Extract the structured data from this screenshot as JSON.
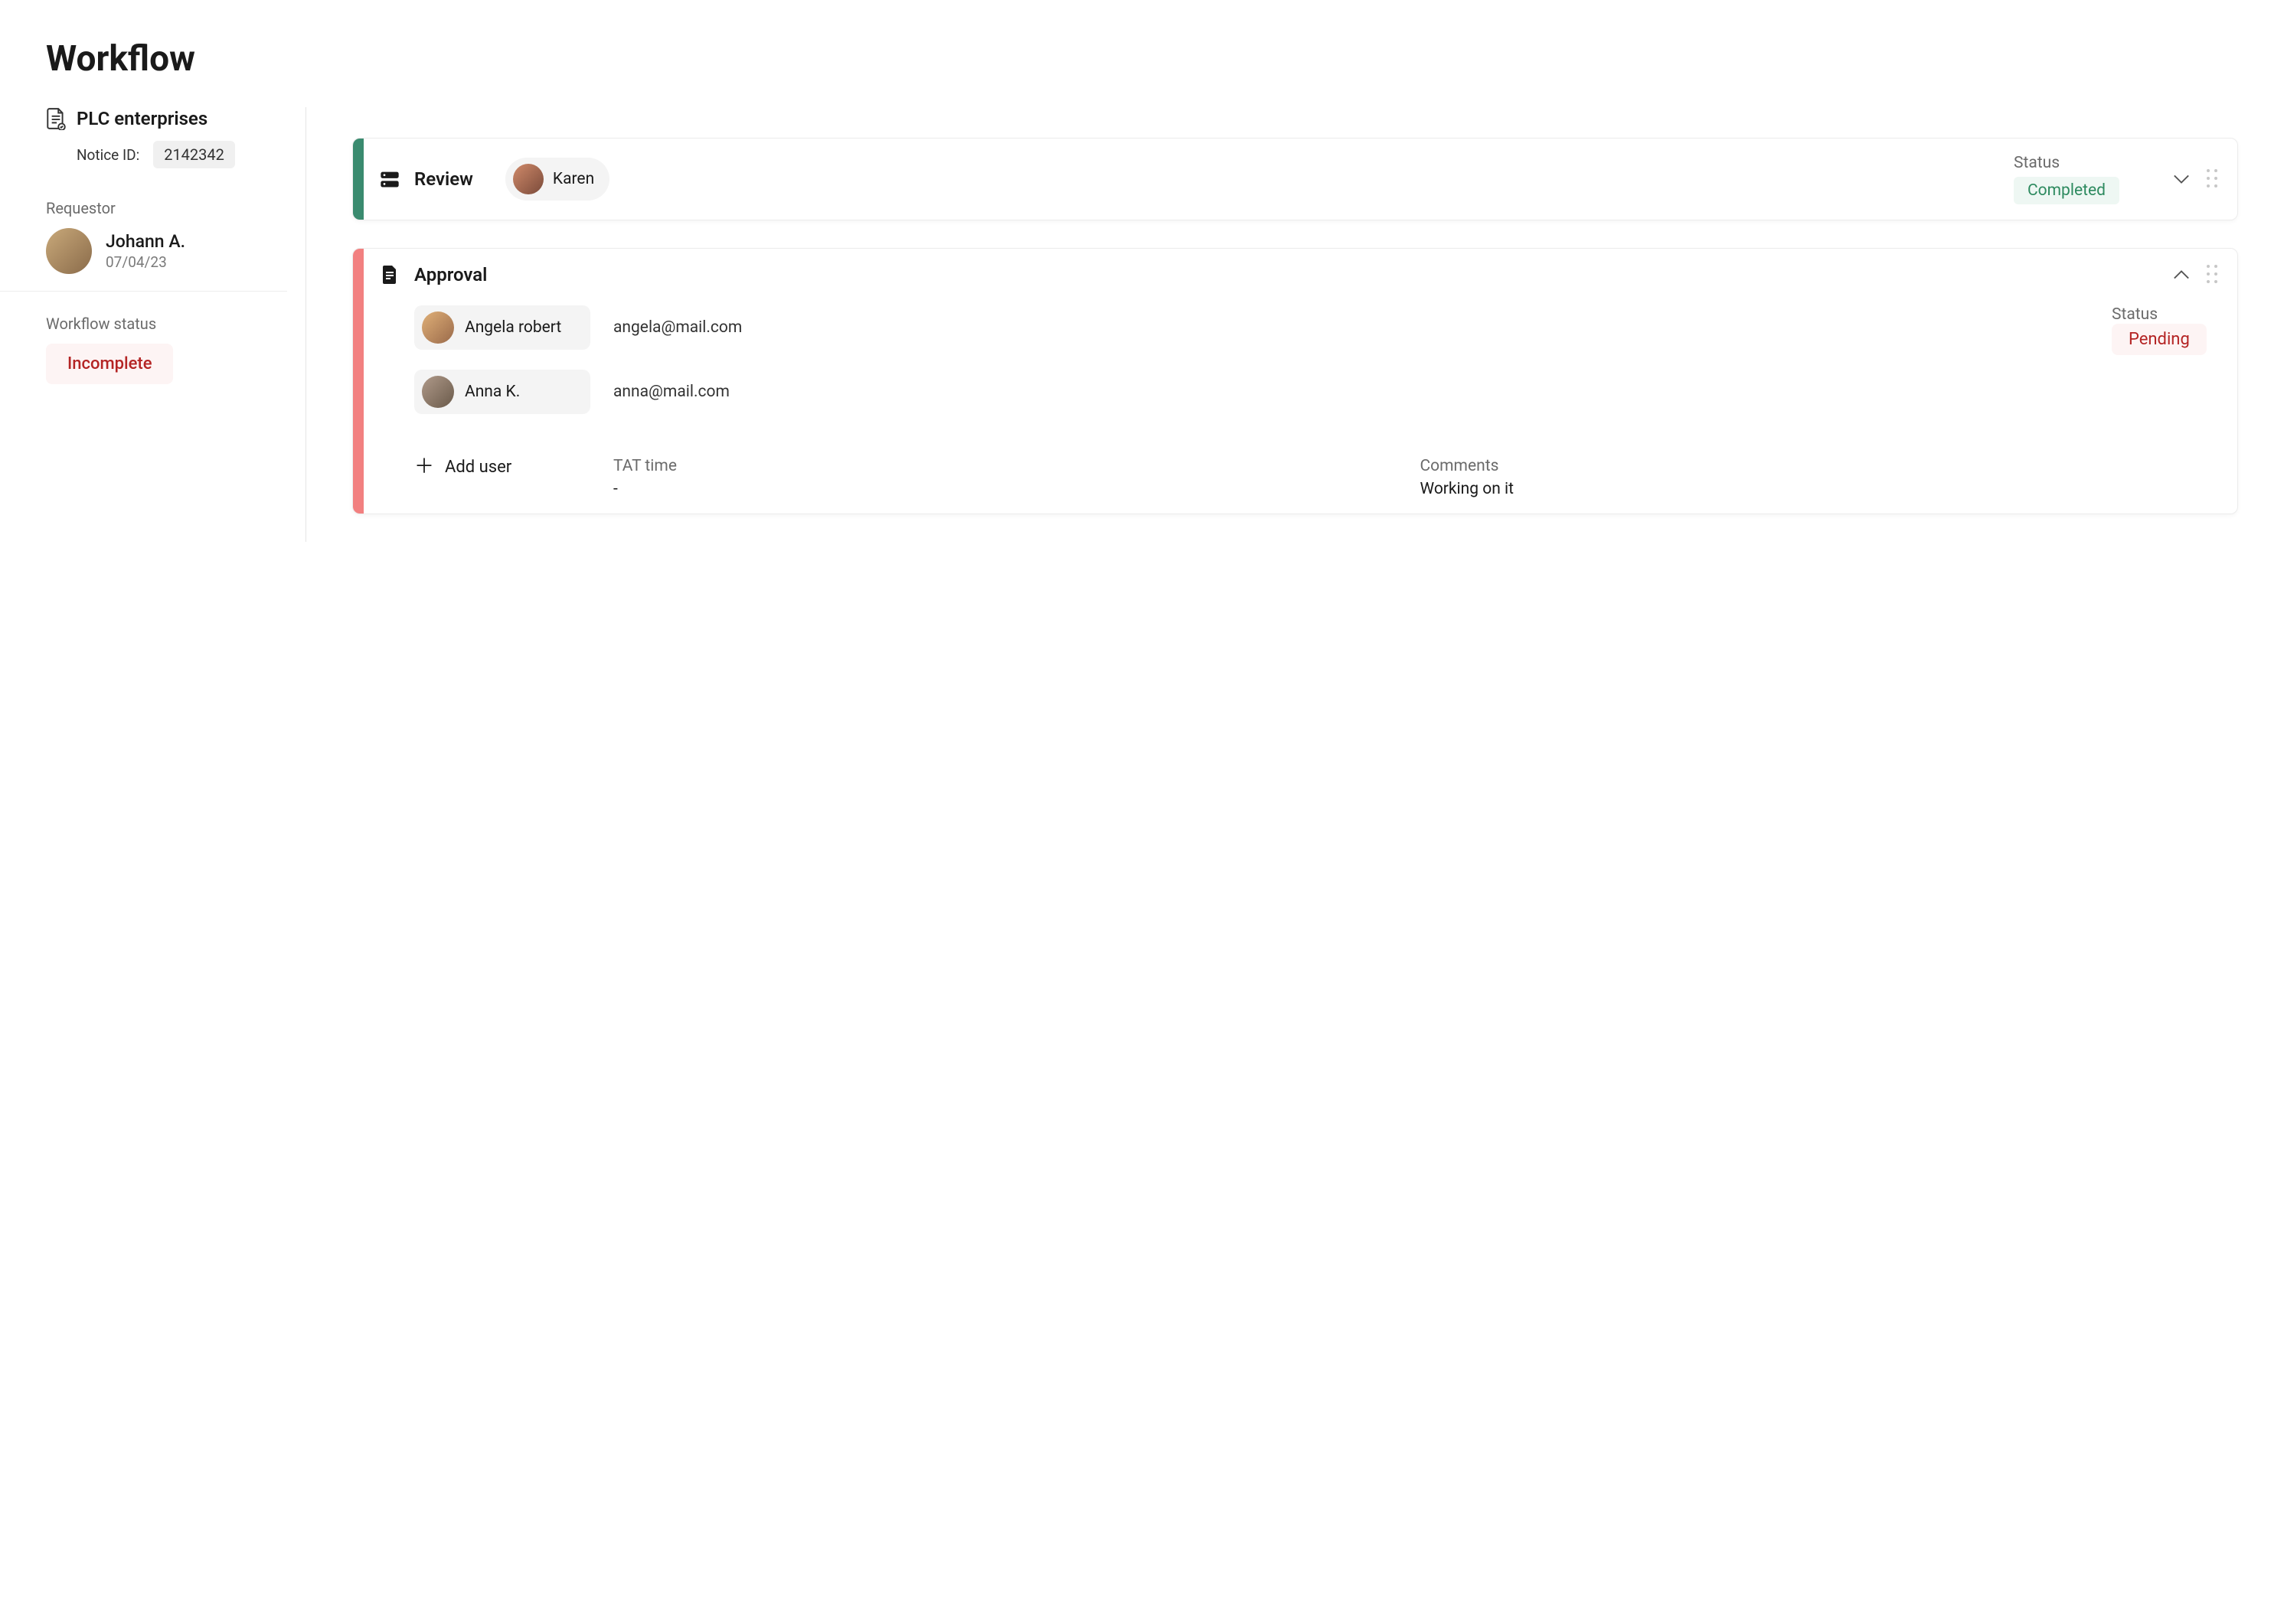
{
  "page_title": "Workflow",
  "sidebar": {
    "company_name": "PLC enterprises",
    "notice_label": "Notice ID:",
    "notice_id": "2142342",
    "requestor_label": "Requestor",
    "requestor_name": "Johann A.",
    "requestor_date": "07/04/23",
    "workflow_status_label": "Workflow status",
    "workflow_status_value": "Incomplete"
  },
  "steps": {
    "review": {
      "title": "Review",
      "assignee": "Karen",
      "status_label": "Status",
      "status_value": "Completed",
      "accent_color": "#3a8b6f"
    },
    "approval": {
      "title": "Approval",
      "accent_color": "#f28080",
      "status_label": "Status",
      "status_value": "Pending",
      "approvers": [
        {
          "name": "Angela robert",
          "email": "angela@mail.com"
        },
        {
          "name": "Anna K.",
          "email": "anna@mail.com"
        }
      ],
      "add_user_label": "Add user",
      "tat_label": "TAT time",
      "tat_value": "-",
      "comments_label": "Comments",
      "comments_value": "Working on it"
    }
  }
}
